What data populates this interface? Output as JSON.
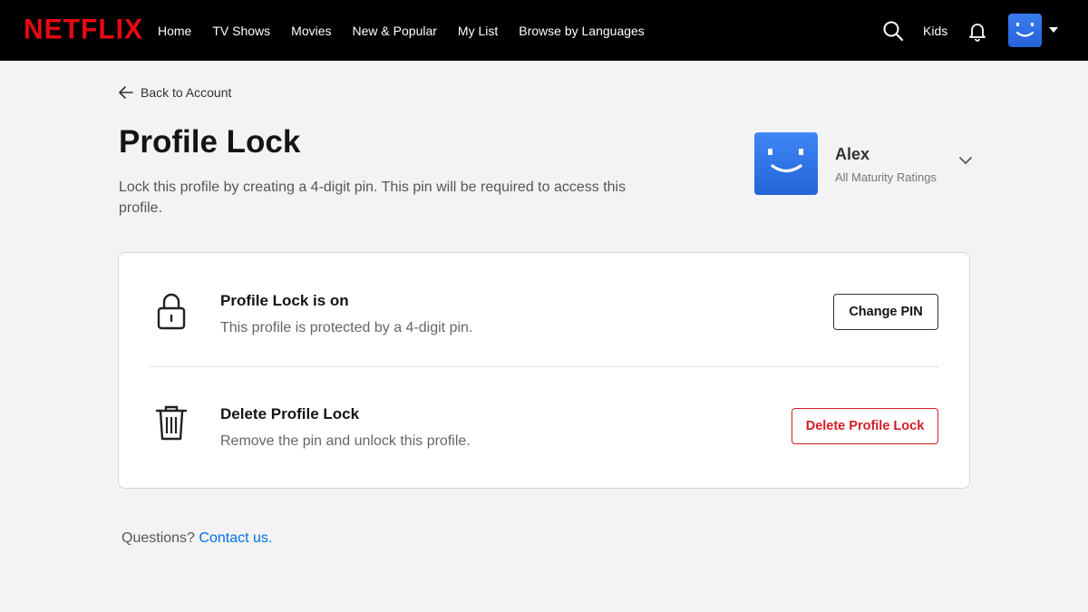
{
  "header": {
    "logo": "NETFLIX",
    "nav": [
      "Home",
      "TV Shows",
      "Movies",
      "New & Popular",
      "My List",
      "Browse by Languages"
    ],
    "kids_label": "Kids",
    "icons": [
      "search-icon",
      "bell-icon",
      "avatar",
      "caret-down-icon"
    ]
  },
  "page": {
    "back_label": "Back to Account",
    "title": "Profile Lock",
    "description": "Lock this profile by creating a 4-digit pin. This pin will be required to access this profile."
  },
  "profile": {
    "name": "Alex",
    "rating": "All Maturity Ratings",
    "avatar_color": "#2f74e6"
  },
  "card": {
    "lock_row": {
      "icon": "lock-icon",
      "title": "Profile Lock is on",
      "subtitle": "This profile is protected by a 4-digit pin.",
      "button": "Change PIN"
    },
    "delete_row": {
      "icon": "trash-icon",
      "title": "Delete Profile Lock",
      "subtitle": "Remove the pin and unlock this profile.",
      "button": "Delete Profile Lock"
    }
  },
  "footer": {
    "question": "Questions?",
    "link": "Contact us."
  },
  "colors": {
    "brand": "#e50914",
    "danger": "#d31d26",
    "link": "#0071eb"
  }
}
